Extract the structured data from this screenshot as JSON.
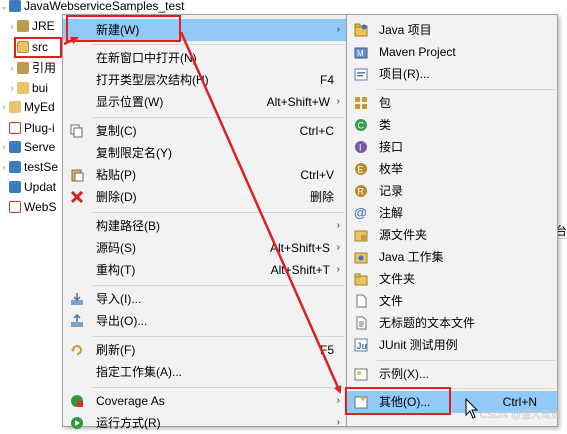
{
  "tree": {
    "items": [
      {
        "label": "JavaWebserviceSamples_test"
      },
      {
        "label": "JRE"
      },
      {
        "label": "src"
      },
      {
        "label": "引用"
      },
      {
        "label": "bui"
      },
      {
        "label": "MyEd"
      },
      {
        "label": "Plug-i"
      },
      {
        "label": "Serve"
      },
      {
        "label": "testSe"
      },
      {
        "label": "Updat"
      },
      {
        "label": "WebS"
      }
    ]
  },
  "context_menu": {
    "items": [
      {
        "label": "新建(W)",
        "shortcut": ""
      },
      {
        "label": "在新窗口中打开(N)",
        "shortcut": ""
      },
      {
        "label": "打开类型层次结构(H)",
        "shortcut": "F4"
      },
      {
        "label": "显示位置(W)",
        "shortcut": "Alt+Shift+W"
      },
      {
        "label": "复制(C)",
        "shortcut": "Ctrl+C"
      },
      {
        "label": "复制限定名(Y)",
        "shortcut": ""
      },
      {
        "label": "粘贴(P)",
        "shortcut": "Ctrl+V"
      },
      {
        "label": "删除(D)",
        "shortcut": "删除"
      },
      {
        "label": "构建路径(B)",
        "shortcut": ""
      },
      {
        "label": "源码(S)",
        "shortcut": "Alt+Shift+S"
      },
      {
        "label": "重构(T)",
        "shortcut": "Alt+Shift+T"
      },
      {
        "label": "导入(I)...",
        "shortcut": ""
      },
      {
        "label": "导出(O)...",
        "shortcut": ""
      },
      {
        "label": "刷新(F)",
        "shortcut": "F5"
      },
      {
        "label": "指定工作集(A)...",
        "shortcut": ""
      },
      {
        "label": "Coverage As",
        "shortcut": ""
      },
      {
        "label": "运行方式(R)",
        "shortcut": ""
      }
    ]
  },
  "submenu": {
    "items": [
      {
        "label": "Java 项目"
      },
      {
        "label": "Maven Project"
      },
      {
        "label": "项目(R)..."
      },
      {
        "label": "包"
      },
      {
        "label": "类"
      },
      {
        "label": "接口"
      },
      {
        "label": "枚举"
      },
      {
        "label": "记录"
      },
      {
        "label": "注解"
      },
      {
        "label": "源文件夹"
      },
      {
        "label": "Java 工作集"
      },
      {
        "label": "文件夹"
      },
      {
        "label": "文件"
      },
      {
        "label": "无标题的文本文件"
      },
      {
        "label": "JUnit 测试用例"
      },
      {
        "label": "示例(X)..."
      },
      {
        "label": "其他(O)...",
        "shortcut": "Ctrl+N"
      }
    ]
  },
  "background": {
    "fragment": "台"
  },
  "watermark": "CSDN @盛大成则"
}
